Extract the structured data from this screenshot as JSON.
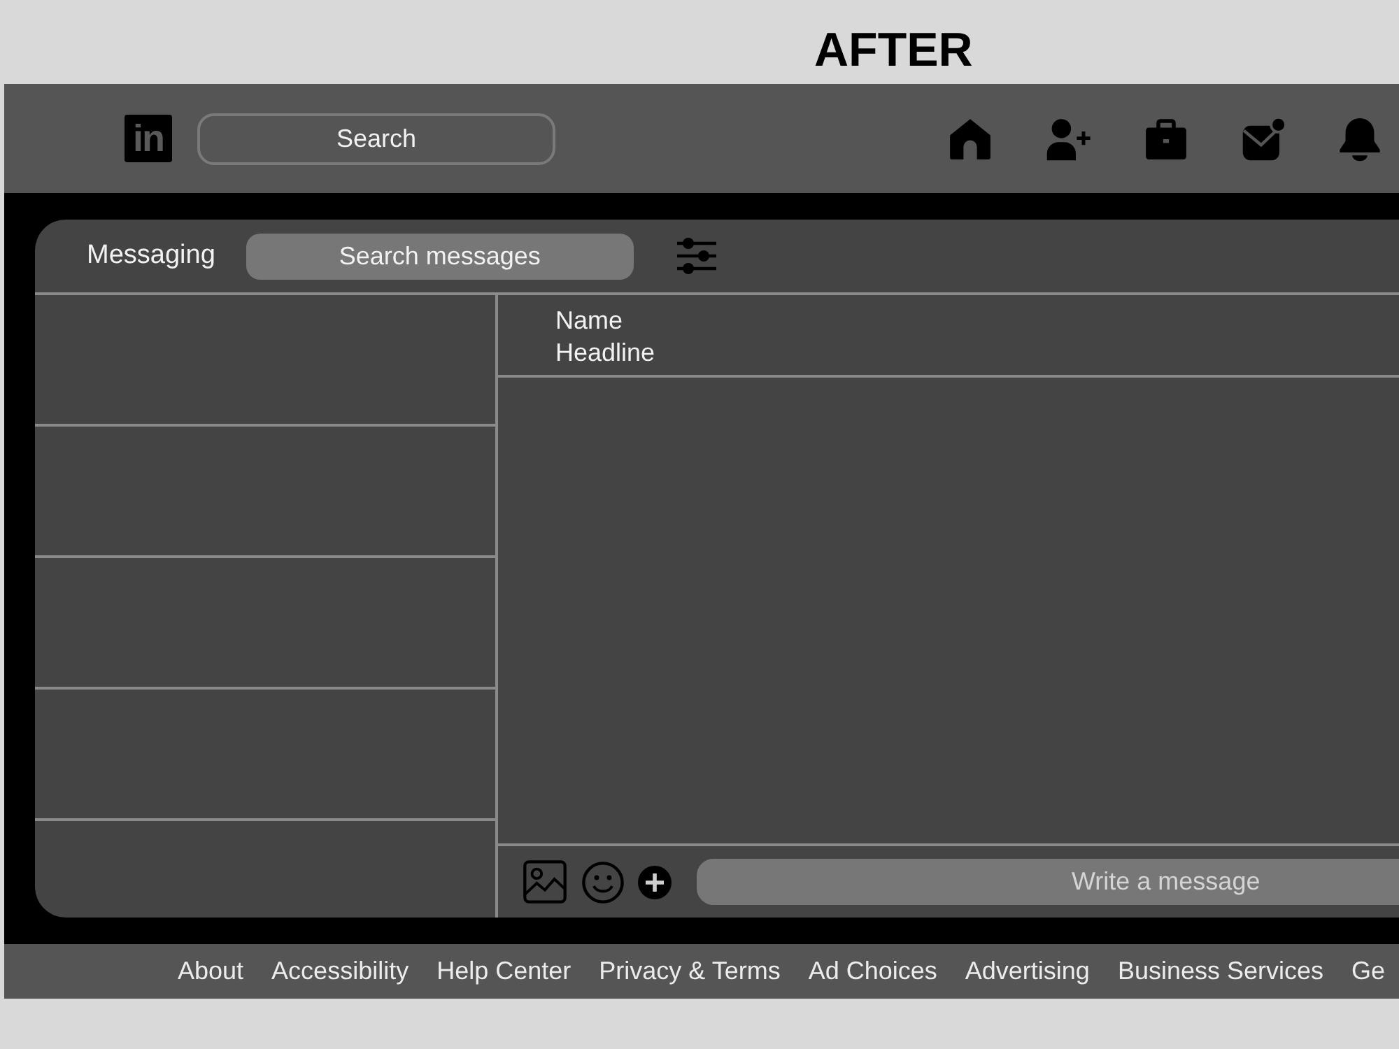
{
  "heading": "AFTER",
  "navbar": {
    "logo": "in",
    "search": {
      "placeholder": "Search"
    }
  },
  "messaging": {
    "title": "Messaging",
    "search": {
      "placeholder": "Search messages"
    }
  },
  "conversation": {
    "name": "Name",
    "headline": "Headline",
    "composer": {
      "placeholder": "Write a message"
    }
  },
  "footer": {
    "links": [
      "About",
      "Accessibility",
      "Help Center",
      "Privacy & Terms",
      "Ad Choices",
      "Advertising",
      "Business Services",
      "Ge"
    ]
  }
}
